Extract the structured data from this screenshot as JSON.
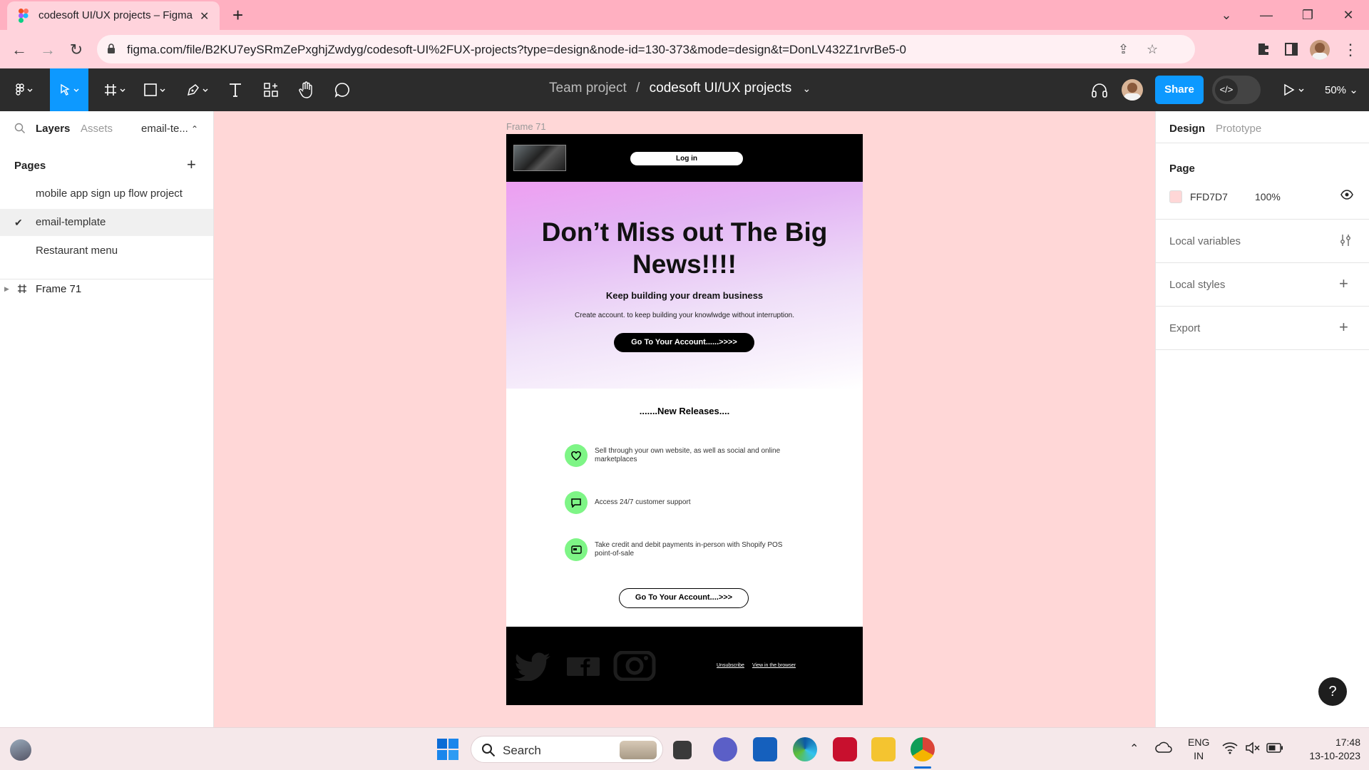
{
  "browser": {
    "tab_title": "codesoft UI/UX projects – Figma",
    "new_tab": "+",
    "url": "figma.com/file/B2KU7eySRmZePxghjZwdyg/codesoft-UI%2FUX-projects?type=design&node-id=130-373&mode=design&t=DonLV432Z1rvrBe5-0"
  },
  "figma": {
    "breadcrumb_team": "Team project",
    "breadcrumb_sep": "/",
    "project_name": "codesoft UI/UX projects",
    "share_label": "Share",
    "zoom": "50%"
  },
  "left_panel": {
    "tab_layers": "Layers",
    "tab_assets": "Assets",
    "current_page_short": "email-te...",
    "pages_header": "Pages",
    "pages": [
      {
        "label": "mobile app sign up flow project"
      },
      {
        "label": "email-template"
      },
      {
        "label": "Restaurant menu"
      }
    ],
    "layer_frame": "Frame 71"
  },
  "right_panel": {
    "tab_design": "Design",
    "tab_prototype": "Prototype",
    "page_header": "Page",
    "page_color_hex": "FFD7D7",
    "page_opacity": "100%",
    "local_variables": "Local variables",
    "local_styles": "Local styles",
    "export": "Export",
    "help": "?"
  },
  "canvas": {
    "frame_label": "Frame 71",
    "login": "Log in",
    "headline": "Don’t Miss out The Big News!!!!",
    "subheadline": "Keep building your dream business",
    "description": "Create account. to keep building your knowlwdge without interruption.",
    "cta_primary": "Go To Your Account......>>>>",
    "new_releases": ".......New Releases....",
    "features": [
      {
        "text": "Sell through your own website, as well as social and online marketplaces",
        "icon": "heart-icon"
      },
      {
        "text": "Access 24/7 customer support",
        "icon": "chat-icon"
      },
      {
        "text": "Take credit and debit payments in-person with Shopify POS point-of-sale",
        "icon": "card-icon"
      }
    ],
    "cta_secondary": "Go To Your Account....>>>",
    "unsubscribe": "Unsubscribe",
    "view_in_browser": "View in the browser"
  },
  "taskbar": {
    "search": "Search",
    "lang_line1": "ENG",
    "lang_line2": "IN",
    "time": "17:48",
    "date": "13-10-2023"
  },
  "colors": {
    "canvas_bg": "#ffd7d7",
    "accent": "#0d99ff",
    "feature_icon_bg": "#7ef586"
  }
}
